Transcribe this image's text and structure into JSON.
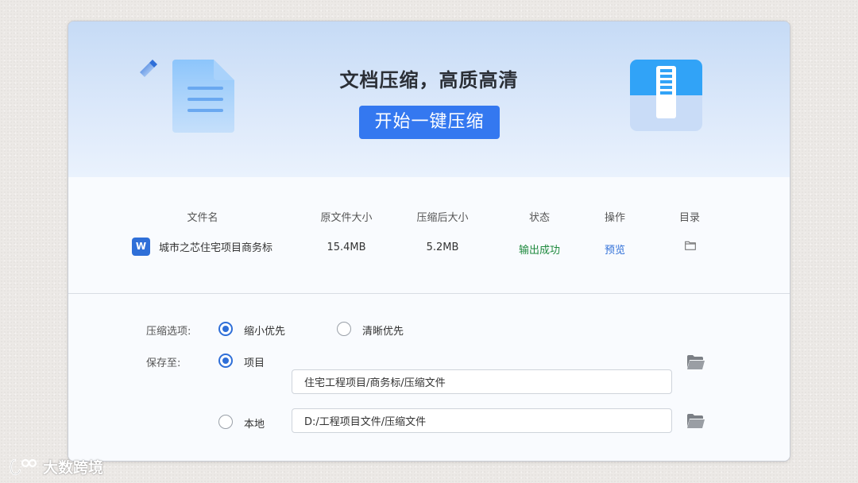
{
  "hero": {
    "title": "文档压缩，高质高清",
    "start_button": "开始一键压缩"
  },
  "table": {
    "headers": {
      "filename": "文件名",
      "original_size": "原文件大小",
      "compressed_size": "压缩后大小",
      "status": "状态",
      "action": "操作",
      "directory": "目录"
    },
    "rows": [
      {
        "file_icon": "word-icon",
        "icon_letter": "W",
        "filename": "城市之芯住宅项目商务标",
        "original_size": "15.4MB",
        "compressed_size": "5.2MB",
        "status": "输出成功",
        "action": "预览"
      }
    ]
  },
  "options": {
    "compress_label": "压缩选项:",
    "compress_choices": [
      "缩小优先",
      "清晰优先"
    ],
    "compress_selected": "缩小优先",
    "save_label": "保存至:",
    "save_choices": [
      {
        "label": "项目",
        "path": "住宅工程项目/商务标/压缩文件",
        "selected": true
      },
      {
        "label": "本地",
        "path": "D:/工程项目文件/压缩文件",
        "selected": false
      }
    ]
  },
  "watermark": {
    "text": "大数跨境"
  },
  "colors": {
    "accent": "#3478f0",
    "success": "#1f8a3e",
    "link": "#2f6fd8",
    "hero_top": "#c6dbf6"
  }
}
